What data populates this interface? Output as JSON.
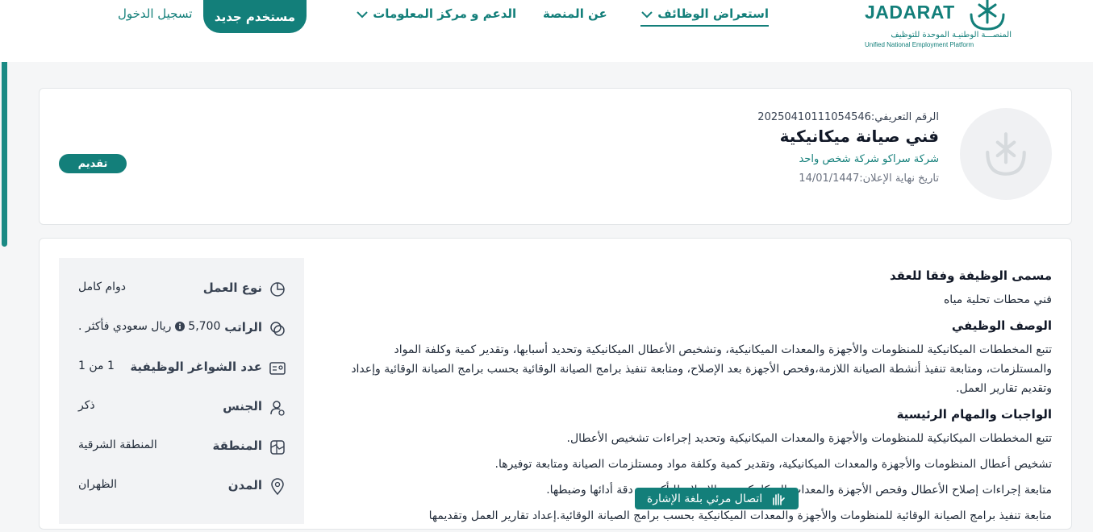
{
  "brand": {
    "name": "JADARAT",
    "arabic_name": "المنصـــة الوطنيـة الموحدة للتوظيف",
    "english_name": "Unified National Employment Platform"
  },
  "nav": {
    "items": [
      {
        "label": "استعراض الوظائف",
        "has_dropdown": true,
        "active": true
      },
      {
        "label": "عن المنصة",
        "has_dropdown": false,
        "active": false
      },
      {
        "label": "الدعم و مركز المعلومات",
        "has_dropdown": true,
        "active": false
      }
    ],
    "new_user": "مستخدم جديد",
    "login": "تسجيل الدخول"
  },
  "job": {
    "id_label": "الرقم التعريفي:",
    "id_value": "20250410111054546",
    "title": "فني صيانة ميكانيكية",
    "company": "شركة سراكو شركة شخص واحد",
    "deadline_label": "تاريخ نهاية الإعلان:",
    "deadline_value": "14/01/1447",
    "apply": "تقديم"
  },
  "description": {
    "contract_title_heading": "مسمى الوظيفة وفقا للعقد",
    "contract_title": "فني محطات تحلية مياه",
    "job_desc_heading": "الوصف الوظيفي",
    "job_desc": "تتبع المخططات الميكانيكية للمنظومات والأجهزة والمعدات الميكانيكية، وتشخيص الأعطال الميكانيكية وتحديد أسبابها، وتقدير كمية وكلفة المواد والمستلزمات، ومتابعة تنفيذ أنشطة الصيانة اللازمة،وفحص الأجهزة بعد الإصلاح، ومتابعة تنفيذ برامج الصيانة الوقائية بحسب برامج الصيانة الوقائية وإعداد وتقديم تقارير العمل.",
    "duties_heading": "الواجبات والمهام الرئيسية",
    "duties": [
      "تتبع المخططات الميكانيكية للمنظومات والأجهزة والمعدات الميكانيكية وتحديد إجراءات تشخيص الأعطال.",
      "تشخيص أعطال المنظومات والأجهزة والمعدات الميكانيكية، وتقدير كمية وكلفة مواد ومستلزمات الصيانة ومتابعة توفيرها.",
      "متابعة إجراءات إصلاح الأعطال وفحص الأجهزة والمعدات الميكانيكية بعد الإصلاح للتأكد من دقة أدائها وضبطها.",
      "متابعة تنفيذ برامج الصيانة الوقائية للمنظومات والأجهزة والمعدات الميكانيكية بحسب برامج الصيانة الوقائية.إعداد تقارير العمل وتقديمها"
    ]
  },
  "details": [
    {
      "label": "نوع العمل",
      "value": "دوام كامل",
      "icon": "pie-chart-icon"
    },
    {
      "label": "الراتب",
      "value": "5,700",
      "suffix": "ريال سعودي فأكثر .",
      "icon": "money-icon"
    },
    {
      "label": "عدد الشواغر الوظيفية",
      "value": "1 من 1",
      "icon": "id-card-icon"
    },
    {
      "label": "الجنس",
      "value": "ذكر",
      "icon": "user-gender-icon"
    },
    {
      "label": "المنطقة",
      "value": "المنطقة الشرقية",
      "icon": "map-icon"
    },
    {
      "label": "المدن",
      "value": "الظهران",
      "icon": "location-pin-icon"
    }
  ],
  "sign_language": "اتصال مرئي بلغة الإشارة",
  "colors": {
    "primary": "#137f7a",
    "background": "#f5f6f7",
    "panel": "#f2f3f5"
  }
}
